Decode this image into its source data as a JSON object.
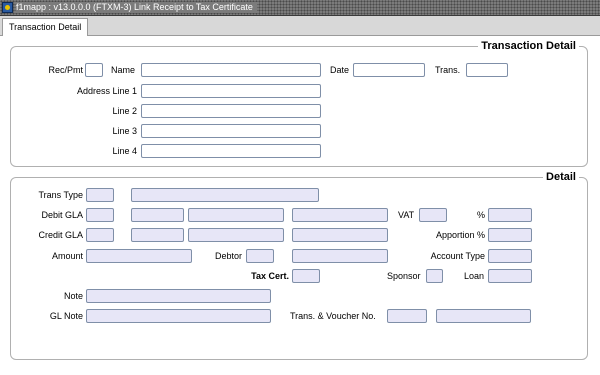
{
  "window": {
    "title": "f1mapp : v13.0.0.0 (FTXM-3) Link Receipt to Tax Certificate"
  },
  "tabs": [
    {
      "label": "Transaction Detail"
    }
  ],
  "transaction_detail": {
    "title": "Transaction Detail",
    "rec_pmt": {
      "label": "Rec/Pmt",
      "value": ""
    },
    "name": {
      "label": "Name",
      "value": ""
    },
    "date": {
      "label": "Date",
      "value": ""
    },
    "trans": {
      "label": "Trans.",
      "value": ""
    },
    "address_line_1": {
      "label": "Address Line 1",
      "value": ""
    },
    "line_2": {
      "label": "Line 2",
      "value": ""
    },
    "line_3": {
      "label": "Line 3",
      "value": ""
    },
    "line_4": {
      "label": "Line 4",
      "value": ""
    }
  },
  "detail": {
    "title": "Detail",
    "trans_type": {
      "label": "Trans Type"
    },
    "debit_gla": {
      "label": "Debit GLA"
    },
    "vat": {
      "label": "VAT"
    },
    "percent": {
      "label": "%"
    },
    "credit_gla": {
      "label": "Credit GLA"
    },
    "apportion": {
      "label": "Apportion %"
    },
    "amount": {
      "label": "Amount"
    },
    "debtor": {
      "label": "Debtor"
    },
    "account_type": {
      "label": "Account Type"
    },
    "tax_cert": {
      "label": "Tax Cert."
    },
    "sponsor": {
      "label": "Sponsor"
    },
    "loan": {
      "label": "Loan"
    },
    "note": {
      "label": "Note"
    },
    "gl_note": {
      "label": "GL Note"
    },
    "trans_voucher": {
      "label": "Trans. & Voucher No."
    }
  },
  "colors": {
    "readonly_field": "#e7e6f7",
    "field_border": "#7f8fa8",
    "group_border": "#b0b0b0"
  },
  "icons": {
    "app": "application-icon"
  }
}
